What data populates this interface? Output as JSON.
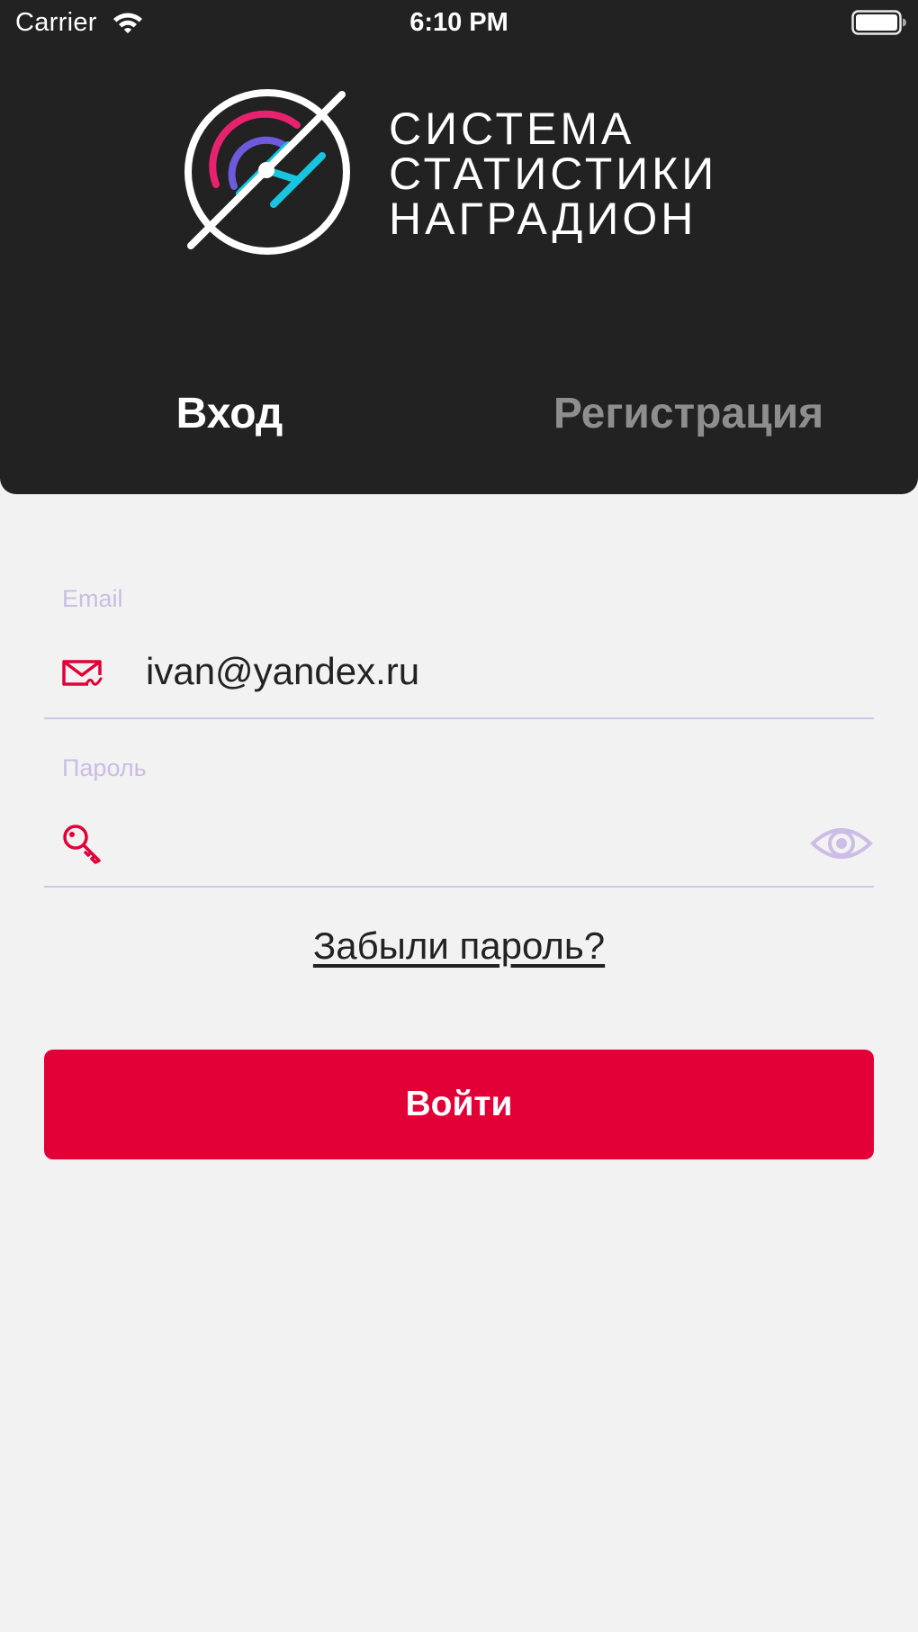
{
  "status_bar": {
    "carrier": "Carrier",
    "time": "6:10 PM",
    "wifi_icon": "wifi-icon",
    "battery_icon": "battery-icon"
  },
  "logo": {
    "mark_icon": "nagradion-logo-mark",
    "lines": [
      "СИСТЕМА",
      "СТАТИСТИКИ",
      "НАГРАДИОН"
    ]
  },
  "tabs": [
    {
      "label": "Вход",
      "active": true
    },
    {
      "label": "Регистрация",
      "active": false
    }
  ],
  "form": {
    "email": {
      "label": "Email",
      "value": "ivan@yandex.ru",
      "icon": "mail-icon"
    },
    "password": {
      "label": "Пароль",
      "value": "",
      "icon": "key-icon",
      "toggle_icon": "eye-icon"
    },
    "forgot_link": "Забыли пароль?",
    "submit_label": "Войти"
  },
  "colors": {
    "header_bg": "#222222",
    "page_bg": "#f2f2f2",
    "accent": "#e20037",
    "field_label": "#c9bde3",
    "inactive_tab": "#8e8e8e"
  }
}
